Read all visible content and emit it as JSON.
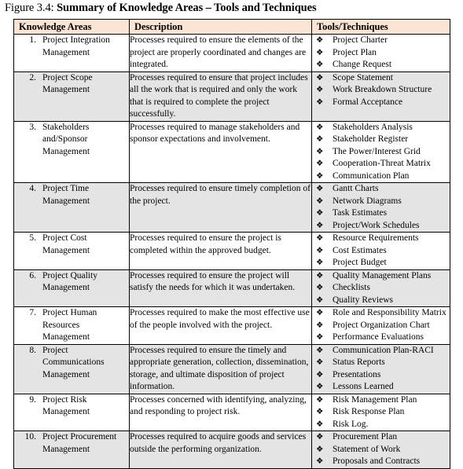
{
  "figure": {
    "label": "Figure 3.4:",
    "title": "Summary of Knowledge Areas – Tools and Techniques"
  },
  "table": {
    "headers": {
      "areas": "Knowledge Areas",
      "description": "Description",
      "tools": "Tools/Techniques"
    },
    "bullet_glyph": "❖",
    "header_bg": "#fbe4d3",
    "alt_row_bg": "#e4e4e4",
    "border_color": "#000000",
    "rows": [
      {
        "num": "1.",
        "area": "Project Integration Management",
        "description": "Processes required to ensure the elements of the project are properly coordinated and changes are integrated.",
        "tools": [
          "Project Charter",
          "Project Plan",
          "Change Request"
        ]
      },
      {
        "num": "2.",
        "area": "Project Scope Management",
        "description": "Processes required to ensure that project includes all the work that is required and only the work that is required to complete the project successfully.",
        "tools": [
          "Scope Statement",
          "Work Breakdown Structure",
          "Formal Acceptance"
        ]
      },
      {
        "num": "3.",
        "area": "Stakeholders and/Sponsor Management",
        "description": "Processes required to manage stakeholders and sponsor expectations and involvement.",
        "tools": [
          "Stakeholders Analysis",
          "Stakeholder Register",
          "The Power/Interest Grid",
          "Cooperation-Threat Matrix",
          "Communication Plan"
        ]
      },
      {
        "num": "4.",
        "area": "Project Time Management",
        "description": "Processes required to ensure timely completion of the project.",
        "tools": [
          "Gantt Charts",
          "Network Diagrams",
          "Task Estimates",
          "Project/Work Schedules"
        ]
      },
      {
        "num": "5.",
        "area": "Project Cost Management",
        "description": "Processes required to ensure the project is completed within the approved budget.",
        "tools": [
          "Resource Requirements",
          "Cost Estimates",
          "Project Budget"
        ]
      },
      {
        "num": "6.",
        "area": "Project Quality Management",
        "description": "Processes required to ensure the project will satisfy the needs for which it was undertaken.",
        "tools": [
          "Quality Management Plans",
          "Checklists",
          "Quality Reviews"
        ]
      },
      {
        "num": "7.",
        "area": "Project Human Resources Management",
        "description": "Processes required to make the most effective use of the people involved with the project.",
        "tools": [
          "Role and Responsibility Matrix",
          "Project Organization Chart",
          "Performance Evaluations"
        ]
      },
      {
        "num": "8.",
        "area": "Project Communications Management",
        "description": "Processes required to ensure the timely and appropriate generation, collection, dissemination, storage, and ultimate disposition of project information.",
        "tools": [
          "Communication Plan-RACI",
          "Status Reports",
          "Presentations",
          "Lessons Learned"
        ]
      },
      {
        "num": "9.",
        "area": "Project Risk Management",
        "description": "Processes concerned with identifying, analyzing, and responding to project risk.",
        "tools": [
          "Risk Management Plan",
          "Risk Response Plan",
          "Risk Log."
        ]
      },
      {
        "num": "10.",
        "area": "Project Procurement Management",
        "description": "Processes required to acquire goods and services outside the performing organization.",
        "tools": [
          "Procurement Plan",
          "Statement of Work",
          "Proposals and Contracts"
        ]
      }
    ]
  }
}
